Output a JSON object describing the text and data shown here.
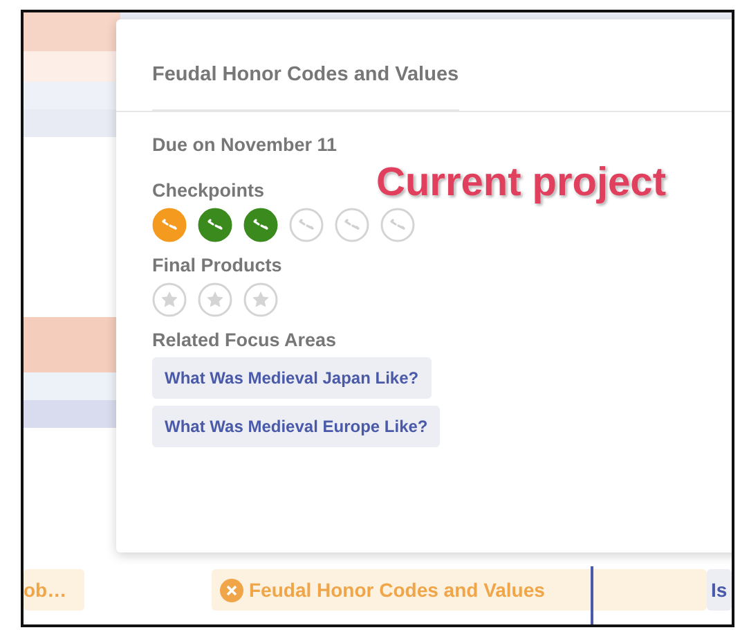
{
  "popup": {
    "title": "Feudal Honor Codes and Values",
    "due": "Due on November 11",
    "annotation": "Current project",
    "checkpoints_label": "Checkpoints",
    "checkpoints": [
      {
        "kind": "current"
      },
      {
        "kind": "done"
      },
      {
        "kind": "done"
      },
      {
        "kind": "open"
      },
      {
        "kind": "open"
      },
      {
        "kind": "open"
      }
    ],
    "final_products_label": "Final Products",
    "final_products": [
      {
        "done": false
      },
      {
        "done": false
      },
      {
        "done": false
      }
    ],
    "related_label": "Related Focus Areas",
    "related": [
      "What Was Medieval Japan Like?",
      "What Was Medieval Europe Like?"
    ]
  },
  "timeline": [
    {
      "label": "ob…",
      "kind": "project",
      "icon": false
    },
    {
      "label": "Feudal Honor Codes and Values",
      "kind": "project",
      "icon": true
    },
    {
      "label": "Is",
      "kind": "focus",
      "icon": false
    }
  ]
}
